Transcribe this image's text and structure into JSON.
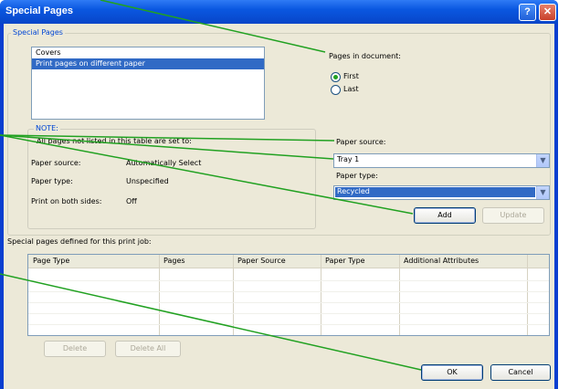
{
  "window": {
    "title": "Special Pages"
  },
  "titlebar_buttons": {
    "help": "?",
    "close": "✕"
  },
  "special_pages_group": {
    "legend": "Special Pages",
    "items": [
      "Covers",
      "Print pages on different paper"
    ],
    "selected_index": 1
  },
  "pages_in_document": {
    "label": "Pages in document:",
    "options": [
      "First",
      "Last"
    ],
    "selected": "First"
  },
  "note": {
    "legend": "NOTE:",
    "text": "All pages not listed in this table are set to:",
    "rows": [
      {
        "label": "Paper source:",
        "value": "Automatically Select"
      },
      {
        "label": "Paper type:",
        "value": "Unspecified"
      },
      {
        "label": "Print on both sides:",
        "value": "Off"
      }
    ]
  },
  "paper_source": {
    "label": "Paper source:",
    "value": "Tray 1"
  },
  "paper_type": {
    "label": "Paper type:",
    "value": "Recycled"
  },
  "buttons": {
    "add": "Add",
    "update": "Update",
    "delete": "Delete",
    "delete_all": "Delete All",
    "ok": "OK",
    "cancel": "Cancel"
  },
  "table": {
    "caption": "Special pages defined for this print job:",
    "columns": [
      "Page Type",
      "Pages",
      "Paper Source",
      "Paper Type",
      "Additional Attributes"
    ]
  },
  "colors": {
    "title_blue": "#0a57e0",
    "accent_green": "#21a121",
    "selection_blue": "#316ac5",
    "face": "#ece9d8"
  },
  "icons": {
    "combo_arrow": "chevron-down-icon",
    "help": "help-icon",
    "close": "close-icon"
  }
}
